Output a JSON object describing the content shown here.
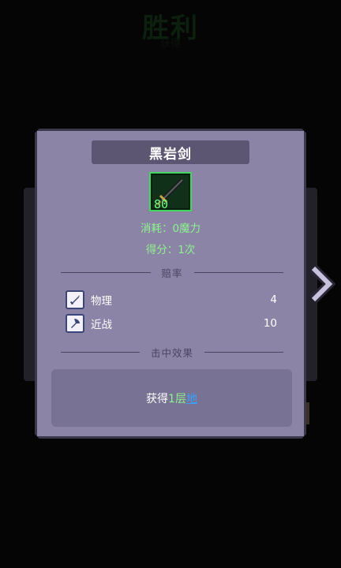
{
  "background": {
    "title": "胜利",
    "subtitle": "获得"
  },
  "card": {
    "item_name": "黑岩剑",
    "item_icon": "sword-icon",
    "item_cost": "80",
    "consume_text": "消耗：0魔力",
    "score_text": "得分：1次",
    "odds_header": "赔率",
    "odds": [
      {
        "icon": "sword-type-icon",
        "label": "物理",
        "value": "4"
      },
      {
        "icon": "melee-type-icon",
        "label": "近战",
        "value": "10"
      }
    ],
    "hit_effect_header": "击中效果",
    "effect": {
      "prefix": "获得",
      "amount": "1层",
      "link": "地"
    }
  },
  "colors": {
    "card_bg": "#8c84a6",
    "name_bar": "#5c5672",
    "green_text": "#8df38d",
    "link_blue": "#3aa0ff"
  },
  "nav": {
    "next_icon": "chevron-right-icon"
  }
}
